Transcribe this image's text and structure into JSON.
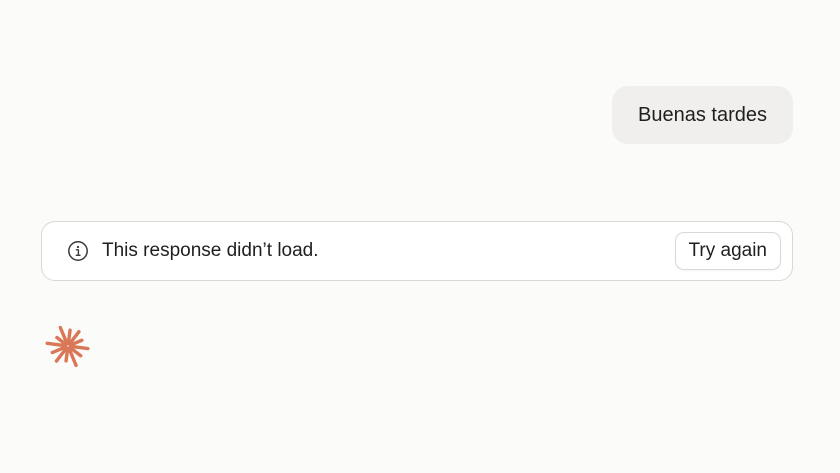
{
  "conversation": {
    "user_message": "Buenas tardes"
  },
  "error_banner": {
    "icon": "info-icon",
    "message": "This response didn’t load.",
    "retry_label": "Try again"
  },
  "assistant": {
    "logo_icon": "spark-icon",
    "accent_color": "#d97757"
  }
}
